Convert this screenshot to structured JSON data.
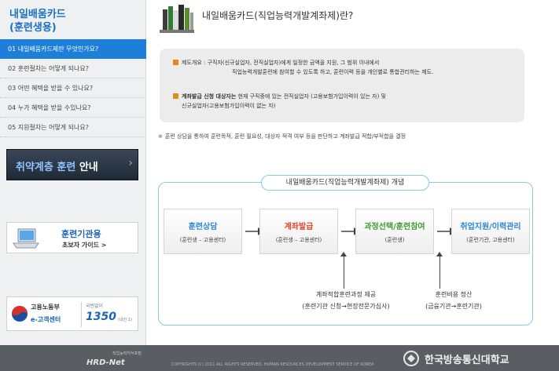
{
  "sidebar": {
    "title_line1": "내일배움카드",
    "title_line2": "(훈련생용)",
    "items": [
      {
        "label": "01 내일배움카드제란 무엇인가요?"
      },
      {
        "label": "02 훈련절차는 어떻게 되나요?"
      },
      {
        "label": "03 어떤 혜택을 받을 수 있나요?"
      },
      {
        "label": "04 누가 혜택을 받을 수있나요?"
      },
      {
        "label": "05 지원절차는 어떻게 되나요?"
      }
    ],
    "banner_vulnerable": {
      "text_part1": "취약계층 훈련",
      "text_part2": " 안내",
      "arrow": "›"
    },
    "banner_institution": {
      "title": "훈련기관용",
      "subtitle": "초보자 가이드  >"
    },
    "banner_moel": {
      "org": "고용노동부",
      "center": "e-고객센터",
      "small": "국번없이",
      "number": "1350",
      "tiny": "(내선:1)"
    }
  },
  "main": {
    "page_title": "내일배움카드(직업능력개발계좌제)란?",
    "info": {
      "line1": "제도개요 : 구직자(신규실업자, 전직실업자)에게 일정한 금액을 지원, 그 범위 이내에서",
      "line2": "직업능력개발훈련에 참여할 수 있도록 하고, 훈련이력 등을 개인별로 통합관리하는 제도.",
      "line3_bold": "계좌발급 신청 대상자는",
      "line3_rest": " 현재 구직중에 있는 전직실업자 (고용보험가입이력이 있는 자) 및",
      "line4": "신규실업자(고용보험가입이력이 없는 자)"
    },
    "note": "훈련 상담을 통하여 훈련목적, 훈련 필요성, 대상자 적격 여부 등을 판단하고 계좌발급 적합/부적합을 결정",
    "note_icon": "※",
    "diagram": {
      "title": "내일배움카드(직업능력개발계좌제) 개념",
      "steps": [
        {
          "title": "훈련상담",
          "sub": "(훈련생 – 고용센터)",
          "color": "#2a86d6"
        },
        {
          "title": "계좌발급",
          "sub": "(훈련생 – 고용센터)",
          "color": "#e0462a"
        },
        {
          "title": "과정선택/훈련참여",
          "sub": "(훈련생)",
          "color": "#3f9a32"
        },
        {
          "title": "취업지원/이력관리",
          "sub": "(훈련기관, 고용센터)",
          "color": "#2a86d6"
        }
      ],
      "bottom1_line1": "계좌적합훈련과정 제공",
      "bottom1_line2": "(훈련기관 신청→현장전문가심사)",
      "bottom2_line1": "훈련비용 정산",
      "bottom2_line2": "(금융기관→훈련기관)"
    }
  },
  "footer": {
    "hrd_small": "직업능력지식포털",
    "hrd_logo": "HRD-Net",
    "copyright": "COPYRIGHTS (C) 2011 ALL RIGHTS RESERVED. HUMAN RESOURCES DEVELOPMENT SERVICE OF KOREA",
    "university": "한국방송통신대학교"
  },
  "colors": {
    "accent": "#1e7fd8",
    "orange_bullet": "#e08a1a",
    "diagram_border": "#8fc6ea"
  },
  "icons": [
    "books-icon",
    "laptop-icon",
    "emblem-icon",
    "arrow-right-icon",
    "university-logo-icon"
  ]
}
